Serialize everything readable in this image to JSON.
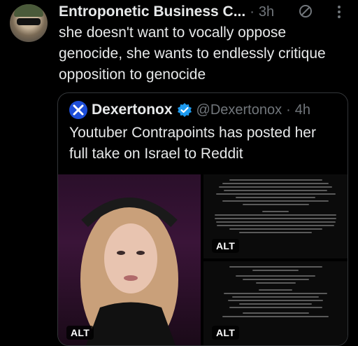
{
  "tweet": {
    "author_name": "Entroponetic Business C...",
    "separator": "·",
    "time": "3h",
    "text": "she doesn't want to vocally oppose genocide, she wants to endlessly critique opposition to genocide"
  },
  "icons": {
    "noop": "no-entry-icon",
    "more": "more-vertical-icon",
    "verified": "verified-badge-icon",
    "quote_logo": "dexertonox-logo-icon"
  },
  "quote": {
    "author_name": "Dexertonox",
    "handle": "@Dexertonox",
    "separator": "·",
    "time": "4h",
    "text": "Youtuber Contrapoints has posted her full take on Israel to Reddit"
  },
  "media": {
    "alt_label": "ALT"
  },
  "colors": {
    "background": "#000000",
    "text_primary": "#e7e9ea",
    "text_secondary": "#71767b",
    "verified": "#1d9bf0",
    "border": "#333639"
  }
}
